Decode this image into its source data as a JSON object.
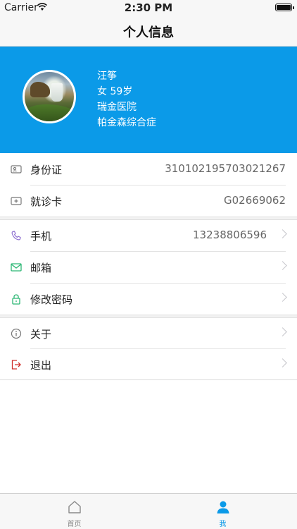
{
  "status_bar": {
    "carrier": "Carrier",
    "time": "2:30 PM"
  },
  "nav": {
    "title": "个人信息"
  },
  "profile": {
    "name": "汪筝",
    "gender_age": "女  59岁",
    "hospital": "瑞金医院",
    "diagnosis": "帕金森综合症"
  },
  "group1": [
    {
      "label": "身份证",
      "value": "310102195703021267",
      "icon": "id-card-icon"
    },
    {
      "label": "就诊卡",
      "value": "G02669062",
      "icon": "medical-card-icon"
    }
  ],
  "group2": [
    {
      "label": "手机",
      "value": "13238806596",
      "icon": "phone-icon"
    },
    {
      "label": "邮箱",
      "value": "",
      "icon": "mail-icon"
    },
    {
      "label": "修改密码",
      "value": "",
      "icon": "lock-icon"
    }
  ],
  "group3": [
    {
      "label": "关于",
      "icon": "info-icon"
    },
    {
      "label": "退出",
      "icon": "logout-icon"
    }
  ],
  "tabbar": [
    {
      "label": "首页",
      "icon": "home-icon",
      "active": false
    },
    {
      "label": "我",
      "icon": "profile-icon",
      "active": true
    }
  ],
  "colors": {
    "accent": "#0b9ae8",
    "phone": "#8e6fd0",
    "mail": "#2bb673",
    "lock": "#2bb673",
    "logout": "#d0312d"
  }
}
